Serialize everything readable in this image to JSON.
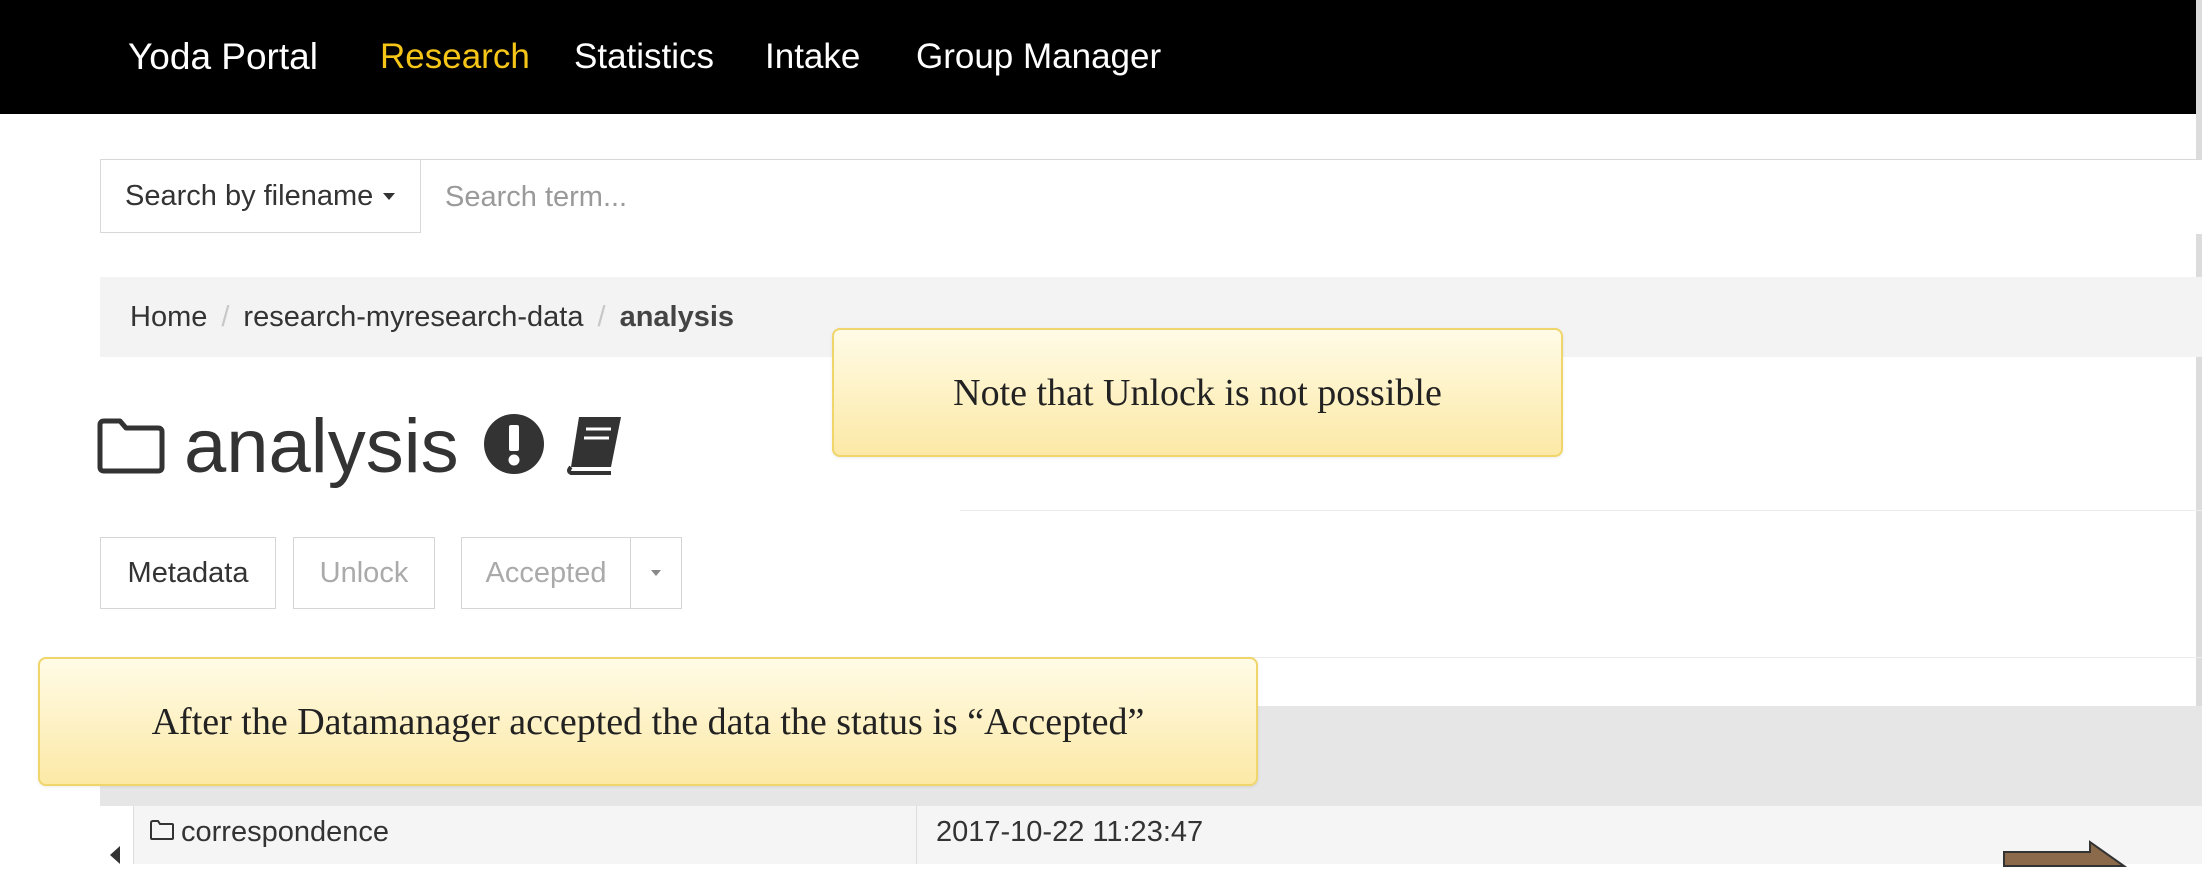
{
  "navbar": {
    "brand": "Yoda Portal",
    "links": [
      {
        "label": "Research",
        "active": true
      },
      {
        "label": "Statistics",
        "active": false
      },
      {
        "label": "Intake",
        "active": false
      },
      {
        "label": "Group Manager",
        "active": false
      }
    ],
    "active_color": "#f5c518",
    "background": "#000000"
  },
  "search": {
    "type_label": "Search by filename",
    "placeholder": "Search term...",
    "value": ""
  },
  "breadcrumb": {
    "items": [
      "Home",
      "research-myresearch-data",
      "analysis"
    ]
  },
  "page": {
    "title": "analysis",
    "icons": [
      "folder-icon",
      "exclamation-circle-icon",
      "book-icon"
    ]
  },
  "actions": {
    "metadata_label": "Metadata",
    "unlock_label": "Unlock",
    "status_label": "Accepted"
  },
  "table": {
    "rows": [
      {
        "name": "correspondence",
        "modified": "2017-10-22 11:23:47",
        "icon": "folder-icon"
      }
    ]
  },
  "callouts": {
    "unlock_note": "Note that Unlock is not possible",
    "status_note": "After the Datamanager accepted the data the status is “Accepted”"
  }
}
